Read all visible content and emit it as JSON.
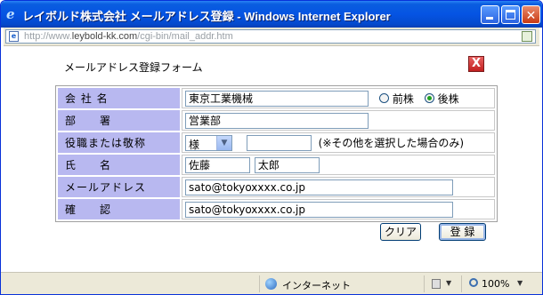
{
  "window": {
    "title": "レイボルド株式会社  メールアドレス登録 - Windows Internet Explorer",
    "controls": [
      "minimize",
      "maximize",
      "close"
    ]
  },
  "address_bar": {
    "url_prefix": "http://www.",
    "url_domain": "leybold-kk.com",
    "url_path": "/cgi-bin/mail_addr.htm"
  },
  "form": {
    "title": "メールアドレス登録フォーム",
    "close_symbol": "X",
    "rows": {
      "company": {
        "label": "会 社 名",
        "value": "東京工業機械",
        "radio_before": "前株",
        "radio_after": "後株",
        "selected": "後株"
      },
      "department": {
        "label": "部　　署",
        "value": "営業部"
      },
      "title": {
        "label": "役職または敬称",
        "select_value": "様",
        "other_value": "",
        "note": "(※その他を選択した場合のみ)"
      },
      "name": {
        "label": "氏　　名",
        "last": "佐藤",
        "first": "太郎"
      },
      "email": {
        "label": "メールアドレス",
        "value": "sato@tokyoxxxx.co.jp"
      },
      "confirm": {
        "label": "確　　認",
        "value": "sato@tokyoxxxx.co.jp"
      }
    },
    "buttons": {
      "clear": "クリア",
      "register": "登 録"
    }
  },
  "status_bar": {
    "zone": "インターネット",
    "zoom": "100%"
  },
  "colors": {
    "label_bg": "#b8b8f0",
    "titlebar": "#0554e3",
    "chrome": "#ece9d8"
  },
  "icons": [
    "ie-icon",
    "page-icon",
    "feed-icon",
    "close-icon",
    "globe-icon",
    "lock-icon",
    "zoom-icon"
  ]
}
